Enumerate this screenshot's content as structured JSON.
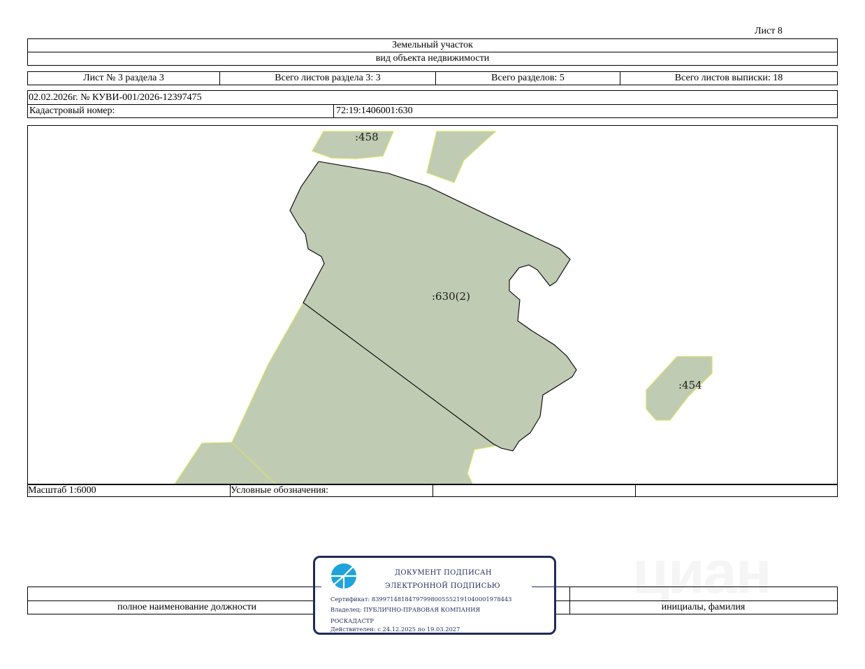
{
  "sheet_label": "Лист 8",
  "header": {
    "object_title": "Земельный участок",
    "object_subtitle": "вид объекта недвижимости"
  },
  "sheet_info": {
    "sheet_of_section": "Лист № 3 раздела 3",
    "total_sheets_section": "Всего листов раздела 3: 3",
    "total_sections": "Всего разделов: 5",
    "total_sheets_extract": "Всего листов выписки: 18"
  },
  "doc_ref": "02.02.2026г. № КУВИ-001/2026-12397475",
  "cadastral": {
    "label": "Кадастровый номер:",
    "value": "72:19:1406001:630"
  },
  "map": {
    "parcel_labels": {
      "main": ":630(2)",
      "north": ":458",
      "east": ":454"
    },
    "colors": {
      "parcel_fill": "#bfcbb3",
      "parcel_edge": "#d6e26a",
      "boundary_line": "#000000"
    }
  },
  "legend_row": {
    "scale": "Масштаб 1:6000",
    "legend_label": "Условные обозначения:"
  },
  "signature": {
    "position_caption": "полное наименование должности",
    "name_caption": "инициалы, фамилия"
  },
  "stamp": {
    "title_line1": "ДОКУМЕНТ ПОДПИСАН",
    "title_line2": "ЭЛЕКТРОННОЙ ПОДПИСЬЮ",
    "certificate": "Сертификат: 839971481847979980055521910400019784​43",
    "owner_line1": "Владелец: ПУБЛИЧНО-ПРАВОВАЯ КОМПАНИЯ",
    "owner_line2": "РОСКАДАСТР",
    "valid": "Действителен: с 24.12.2025 по 19.03.2027",
    "logo_color": "#1ea3dc",
    "border_color": "#1f2a5a"
  },
  "watermark": "циан",
  "icons": {
    "stamp_logo": "roskadastr-logo-icon"
  }
}
